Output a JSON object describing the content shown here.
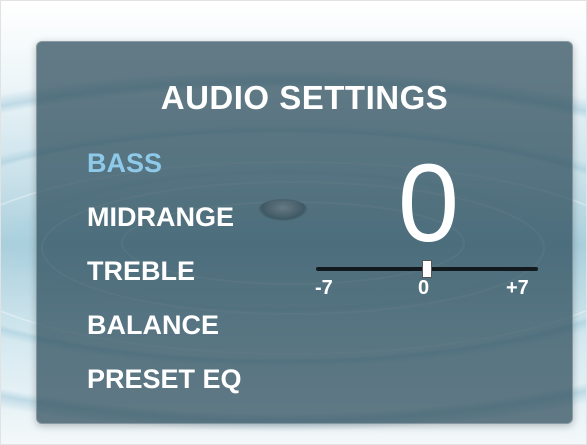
{
  "panel": {
    "title": "AUDIO SETTINGS"
  },
  "menu": {
    "items": [
      {
        "label": "BASS",
        "active": true
      },
      {
        "label": "MIDRANGE",
        "active": false
      },
      {
        "label": "TREBLE",
        "active": false
      },
      {
        "label": "BALANCE",
        "active": false
      },
      {
        "label": "PRESET EQ",
        "active": false
      }
    ]
  },
  "value_display": {
    "value": "0"
  },
  "slider": {
    "min_label": "-7",
    "mid_label": "0",
    "max_label": "+7",
    "min": -7,
    "max": 7,
    "value": 0
  },
  "colors": {
    "active_item": "#8fc9ea",
    "text": "#ffffff",
    "panel": "#284858"
  },
  "icons": {
    "background_decoration": "water-drop"
  }
}
